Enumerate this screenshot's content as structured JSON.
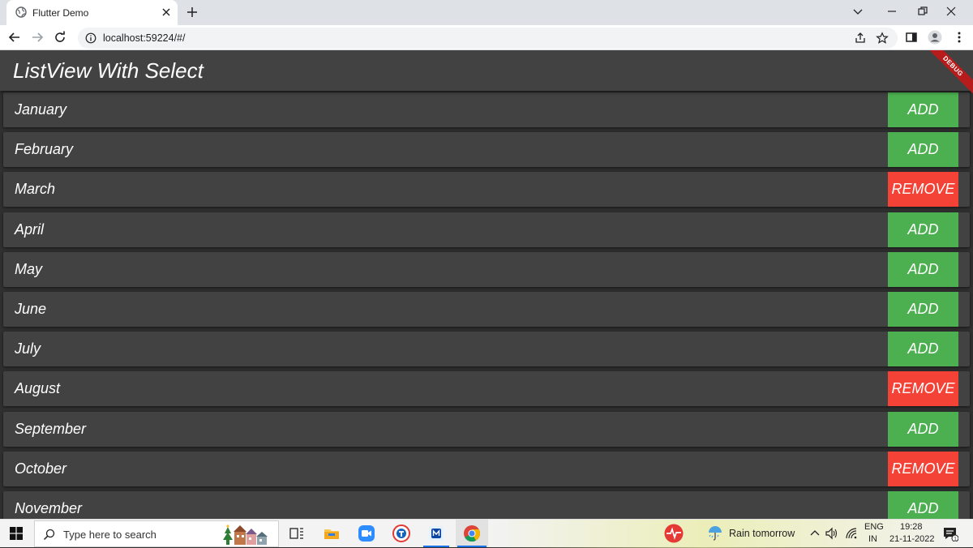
{
  "browser": {
    "tab_title": "Flutter Demo",
    "url": "localhost:59224/#/"
  },
  "app": {
    "title": "ListView With Select",
    "debug_banner": "DEBUG",
    "colors": {
      "appbar": "#424242",
      "row": "#424242",
      "background": "#303030",
      "add": "#4caf50",
      "remove": "#f44336"
    },
    "rows": [
      {
        "label": "January",
        "action": "ADD"
      },
      {
        "label": "February",
        "action": "ADD"
      },
      {
        "label": "March",
        "action": "REMOVE"
      },
      {
        "label": "April",
        "action": "ADD"
      },
      {
        "label": "May",
        "action": "ADD"
      },
      {
        "label": "June",
        "action": "ADD"
      },
      {
        "label": "July",
        "action": "ADD"
      },
      {
        "label": "August",
        "action": "REMOVE"
      },
      {
        "label": "September",
        "action": "ADD"
      },
      {
        "label": "October",
        "action": "REMOVE"
      },
      {
        "label": "November",
        "action": "ADD"
      }
    ]
  },
  "taskbar": {
    "search_placeholder": "Type here to search",
    "weather": "Rain tomorrow",
    "lang_top": "ENG",
    "lang_bottom": "IN",
    "time": "19:28",
    "date": "21-11-2022"
  }
}
